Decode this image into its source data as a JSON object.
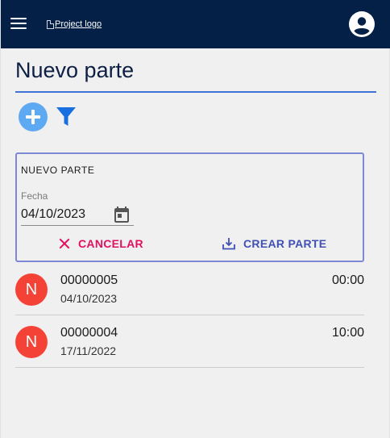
{
  "header": {
    "logo_alt": "Project logo",
    "menu_icon": "hamburger-menu-icon",
    "account_icon": "account-circle-icon",
    "background_color": "#042047"
  },
  "page": {
    "title": "Nuevo parte",
    "accent_color": "#3f74d6"
  },
  "actions": {
    "add_icon": "add-circle-icon",
    "filter_icon": "filter-icon"
  },
  "form": {
    "title": "NUEVO PARTE",
    "date_label": "Fecha",
    "date_value": "04/10/2023",
    "calendar_icon": "calendar-icon",
    "cancel_label": "CANCELAR",
    "cancel_icon": "close-icon",
    "cancel_color": "#e0115f",
    "create_label": "CREAR PARTE",
    "create_icon": "download-tray-icon",
    "create_color": "#3f51b5"
  },
  "list": {
    "items": [
      {
        "avatar": "N",
        "code": "00000005",
        "date": "04/10/2023",
        "time": "00:00"
      },
      {
        "avatar": "N",
        "code": "00000004",
        "date": "17/11/2022",
        "time": "10:00"
      }
    ],
    "avatar_color": "#f44336"
  }
}
